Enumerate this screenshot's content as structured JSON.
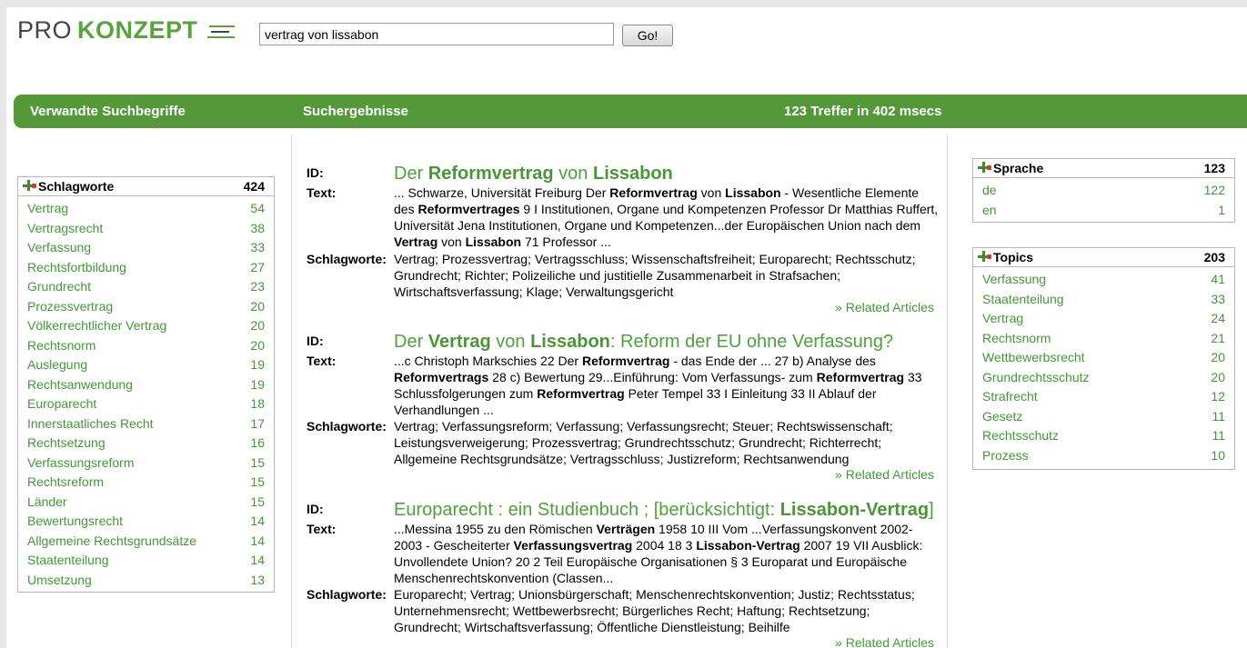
{
  "header": {
    "logo_pro": "PRO",
    "logo_konzept": "KONZEPT",
    "search_value": "vertrag von lissabon",
    "go_label": "Go!"
  },
  "bar": {
    "related_terms": "Verwandte Suchbegriffe",
    "results": "Suchergebnisse",
    "hits": "123 Treffer in 402 msecs"
  },
  "left_box": {
    "title": "Schlagworte",
    "count": "424",
    "items": [
      {
        "term": "Vertrag",
        "count": "54"
      },
      {
        "term": "Vertragsrecht",
        "count": "38"
      },
      {
        "term": "Verfassung",
        "count": "33"
      },
      {
        "term": "Rechtsfortbildung",
        "count": "27"
      },
      {
        "term": "Grundrecht",
        "count": "23"
      },
      {
        "term": "Prozessvertrag",
        "count": "20"
      },
      {
        "term": "Völkerrechtlicher Vertrag",
        "count": "20"
      },
      {
        "term": "Rechtsnorm",
        "count": "20"
      },
      {
        "term": "Auslegung",
        "count": "19"
      },
      {
        "term": "Rechtsanwendung",
        "count": "19"
      },
      {
        "term": "Europarecht",
        "count": "18"
      },
      {
        "term": "Innerstaatliches Recht",
        "count": "17"
      },
      {
        "term": "Rechtsetzung",
        "count": "16"
      },
      {
        "term": "Verfassungsreform",
        "count": "15"
      },
      {
        "term": "Rechtsreform",
        "count": "15"
      },
      {
        "term": "Länder",
        "count": "15"
      },
      {
        "term": "Bewertungsrecht",
        "count": "14"
      },
      {
        "term": "Allgemeine Rechtsgrundsätze",
        "count": "14"
      },
      {
        "term": "Staatenteilung",
        "count": "14"
      },
      {
        "term": "Umsetzung",
        "count": "13"
      }
    ]
  },
  "language_box": {
    "title": "Sprache",
    "count": "123",
    "items": [
      {
        "term": "de",
        "count": "122"
      },
      {
        "term": "en",
        "count": "1"
      }
    ]
  },
  "topics_box": {
    "title": "Topics",
    "count": "203",
    "items": [
      {
        "term": "Verfassung",
        "count": "41"
      },
      {
        "term": "Staatenteilung",
        "count": "33"
      },
      {
        "term": "Vertrag",
        "count": "24"
      },
      {
        "term": "Rechtsnorm",
        "count": "21"
      },
      {
        "term": "Wettbewerbsrecht",
        "count": "20"
      },
      {
        "term": "Grundrechtsschutz",
        "count": "20"
      },
      {
        "term": "Strafrecht",
        "count": "12"
      },
      {
        "term": "Gesetz",
        "count": "11"
      },
      {
        "term": "Rechtsschutz",
        "count": "11"
      },
      {
        "term": "Prozess",
        "count": "10"
      }
    ]
  },
  "labels": {
    "id": "ID:",
    "text": "Text:",
    "keywords": "Schlagworte:",
    "related": "» Related Articles"
  },
  "results": [
    {
      "title": [
        [
          "Der ",
          false
        ],
        [
          "Reformvertrag",
          true
        ],
        [
          " von ",
          false
        ],
        [
          "Lissabon",
          true
        ]
      ],
      "text": [
        [
          "... Schwarze, Universität Freiburg Der ",
          false
        ],
        [
          "Reformvertrag",
          true
        ],
        [
          " von ",
          false
        ],
        [
          "Lissabon",
          true
        ],
        [
          " - Wesentliche Elemente des ",
          false
        ],
        [
          "Reformvertrages",
          true
        ],
        [
          " 9 I Institutionen, Organe und Kompetenzen Professor Dr Matthias Ruffert, Universität Jena Institutionen, Organe und Kompetenzen...der Europäischen Union nach dem ",
          false
        ],
        [
          "Vertrag",
          true
        ],
        [
          " von ",
          false
        ],
        [
          "Lissabon",
          true
        ],
        [
          " 71 Professor ...",
          false
        ]
      ],
      "keywords": "Vertrag; Prozessvertrag; Vertragsschluss; Wissenschaftsfreiheit; Europarecht; Rechtsschutz; Grundrecht; Richter; Polizeiliche und justitielle Zusammenarbeit in Strafsachen; Wirtschaftsverfassung; Klage; Verwaltungsgericht"
    },
    {
      "title": [
        [
          "Der ",
          false
        ],
        [
          "Vertrag",
          true
        ],
        [
          " von ",
          false
        ],
        [
          "Lissabon",
          true
        ],
        [
          ": Reform der EU ohne Verfassung?",
          false
        ]
      ],
      "text": [
        [
          "...c Christoph Markschies 22 Der ",
          false
        ],
        [
          "Reformvertrag",
          true
        ],
        [
          " - das Ende der ... 27 b) Analyse des ",
          false
        ],
        [
          "Reformvertrags",
          true
        ],
        [
          " 28 c) Bewertung 29...Einführung: Vom Verfassungs- zum ",
          false
        ],
        [
          "Reformvertrag",
          true
        ],
        [
          " 33 Schlussfolgerungen zum ",
          false
        ],
        [
          "Reformvertrag",
          true
        ],
        [
          " Peter Tempel 33 I Einleitung 33 II Ablauf der Verhandlungen ...",
          false
        ]
      ],
      "keywords": "Vertrag; Verfassungsreform; Verfassung; Verfassungsrecht; Steuer; Rechtswissenschaft; Leistungsverweigerung; Prozessvertrag; Grundrechtsschutz; Grundrecht; Richterrecht; Allgemeine Rechtsgrundsätze; Vertragsschluss; Justizreform; Rechtsanwendung"
    },
    {
      "title": [
        [
          "Europarecht : ein Studienbuch ; [berücksichtigt: ",
          false
        ],
        [
          "Lissabon-Vertrag",
          true
        ],
        [
          "]",
          false
        ]
      ],
      "text": [
        [
          "...Messina 1955 zu den Römischen ",
          false
        ],
        [
          "Verträgen",
          true
        ],
        [
          " 1958 10 III Vom ...Verfassungskonvent 2002-2003 - Gescheiterter ",
          false
        ],
        [
          "Verfassungsvertrag",
          true
        ],
        [
          " 2004 18 3 ",
          false
        ],
        [
          "Lissabon-Vertrag",
          true
        ],
        [
          " 2007 19 VII Ausblick: Unvollendete Union? 20 2 Teil Europäische Organisationen § 3 Europarat und Europäische Menschenrechtskonvention (Classen...",
          false
        ]
      ],
      "keywords": "Europarecht; Vertrag; Unionsbürgerschaft; Menschenrechtskonvention; Justiz; Rechtsstatus; Unternehmensrecht; Wettbewerbsrecht; Bürgerliches Recht; Haftung; Rechtsetzung; Grundrecht; Wirtschaftsverfassung; Öffentliche Dienstleistung; Beihilfe"
    }
  ]
}
